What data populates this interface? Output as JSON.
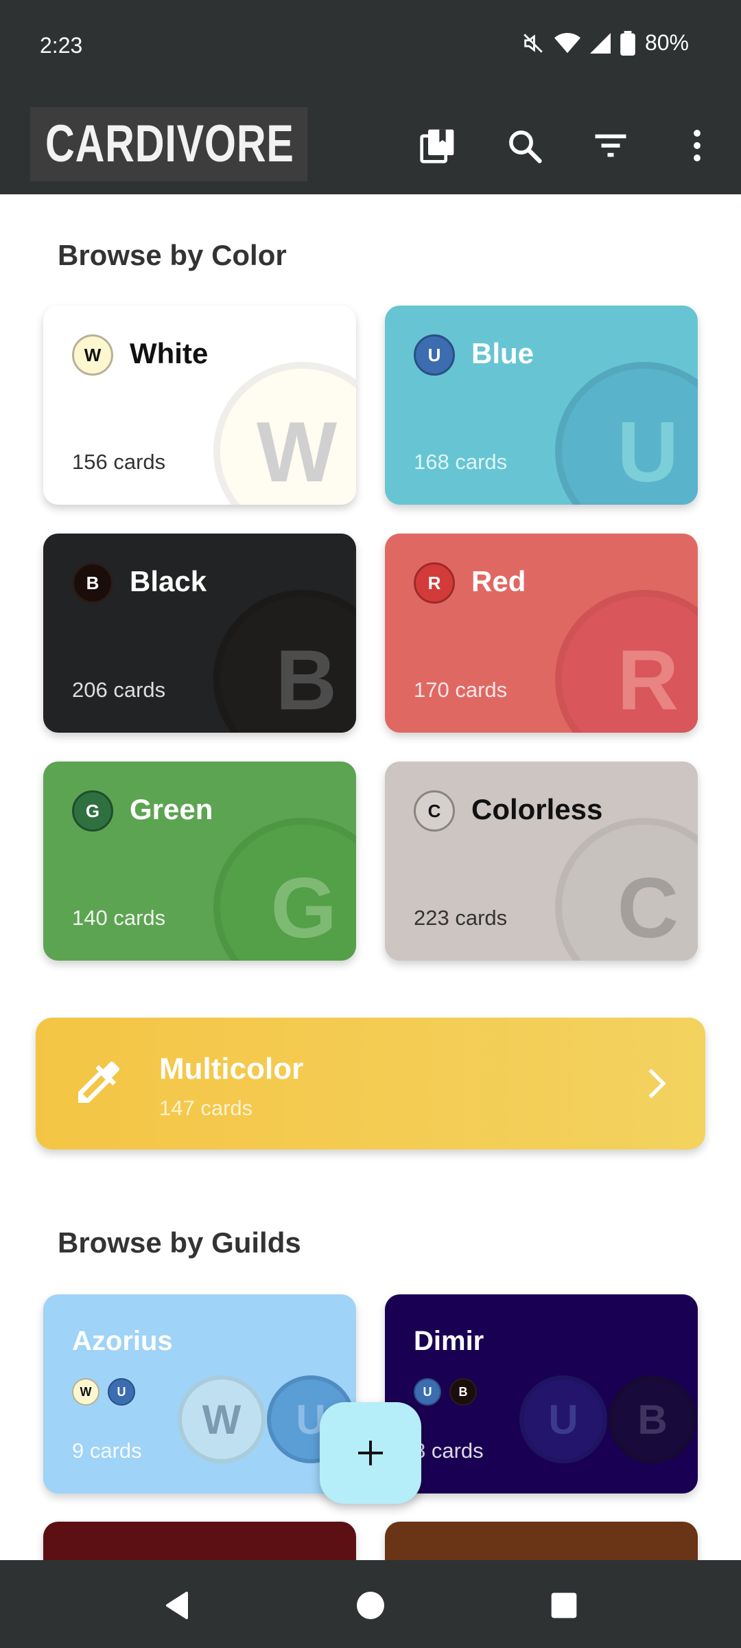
{
  "status_bar": {
    "time": "2:23",
    "battery": "80%"
  },
  "app_bar": {
    "logo_text": "CARDIVORE",
    "icons": [
      "collection-icon",
      "search-icon",
      "filter-icon",
      "more-vert-icon"
    ]
  },
  "browse_color": {
    "title": "Browse by Color",
    "cards": [
      {
        "symbol": "W",
        "name": "White",
        "count": "156 cards",
        "bg": "#ffffff"
      },
      {
        "symbol": "U",
        "name": "Blue",
        "count": "168 cards",
        "bg": "#67c5d3"
      },
      {
        "symbol": "B",
        "name": "Black",
        "count": "206 cards",
        "bg": "#222324"
      },
      {
        "symbol": "R",
        "name": "Red",
        "count": "170 cards",
        "bg": "#e06863"
      },
      {
        "symbol": "G",
        "name": "Green",
        "count": "140 cards",
        "bg": "#5da452"
      },
      {
        "symbol": "C",
        "name": "Colorless",
        "count": "223 cards",
        "bg": "#ccc5c2"
      }
    ]
  },
  "multicolor": {
    "icon": "eyedropper-icon",
    "title": "Multicolor",
    "count": "147 cards"
  },
  "browse_guilds": {
    "title": "Browse by Guilds",
    "cards": [
      {
        "name": "Azorius",
        "symbols": [
          "W",
          "U"
        ],
        "count": "9 cards",
        "bg": "#9fd3f7"
      },
      {
        "name": "Dimir",
        "symbols": [
          "U",
          "B"
        ],
        "count": "8 cards",
        "bg": "#1a0052"
      }
    ]
  },
  "fab": {
    "icon": "plus-icon"
  },
  "nav": {
    "icons": [
      "back-icon",
      "home-icon",
      "recents-icon"
    ]
  }
}
